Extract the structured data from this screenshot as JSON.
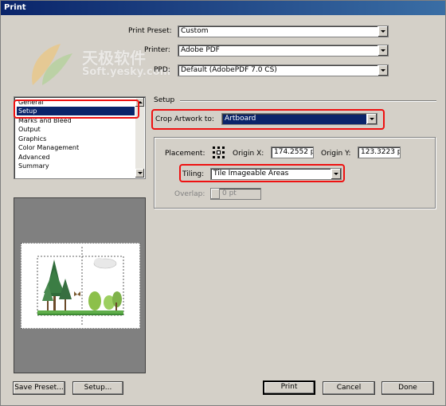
{
  "window": {
    "title": "Print"
  },
  "preset": {
    "label": "Print Preset:",
    "value": "Custom"
  },
  "printer": {
    "label": "Printer:",
    "value": "Adobe PDF"
  },
  "ppd": {
    "label": "PPD:",
    "value": "Default (AdobePDF 7.0 CS)"
  },
  "watermark": {
    "cn": "天极软件",
    "en": "Soft.yesky.com"
  },
  "categories": [
    "General",
    "Setup",
    "Marks and Bleed",
    "Output",
    "Graphics",
    "Color Management",
    "Advanced",
    "Summary"
  ],
  "section_title": "Setup",
  "crop": {
    "label": "Crop Artwork to:",
    "value": "Artboard"
  },
  "placement": {
    "label": "Placement:",
    "origin_x_label": "Origin X:",
    "origin_x_value": "174.2552 p",
    "origin_y_label": "Origin Y:",
    "origin_y_value": "123.3223 p"
  },
  "tiling": {
    "label": "Tiling:",
    "value": "Tile Imageable Areas"
  },
  "overlap": {
    "label": "Overlap:",
    "value": "0 pt"
  },
  "buttons": {
    "save_preset": "Save Preset...",
    "setup": "Setup...",
    "print": "Print",
    "cancel": "Cancel",
    "done": "Done"
  },
  "colors": {
    "highlight": "#0a246a",
    "annotation": "#e11111",
    "dialog_bg": "#d4d0c8"
  }
}
